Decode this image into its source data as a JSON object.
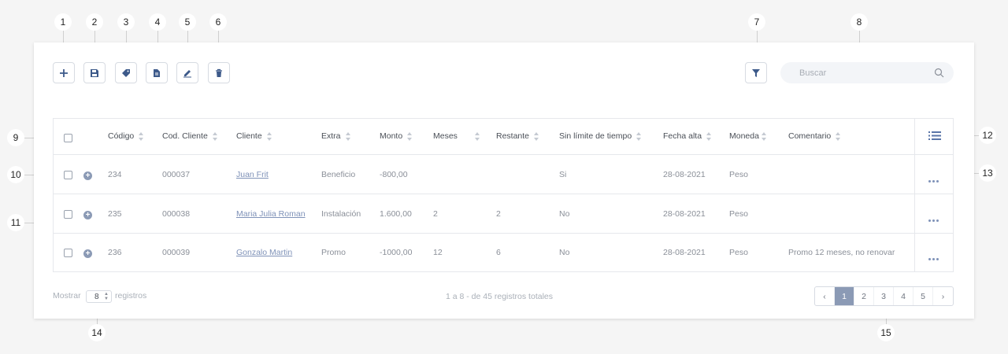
{
  "callouts": [
    "1",
    "2",
    "3",
    "4",
    "5",
    "6",
    "7",
    "8",
    "9",
    "10",
    "11",
    "12",
    "13",
    "14",
    "15"
  ],
  "toolbar": {
    "buttons": [
      {
        "icon": "plus-icon",
        "name": "add-button"
      },
      {
        "icon": "save-icon",
        "name": "save-button"
      },
      {
        "icon": "tag-icon",
        "name": "tag-button"
      },
      {
        "icon": "document-icon",
        "name": "document-button"
      },
      {
        "icon": "edit-icon",
        "name": "edit-button"
      },
      {
        "icon": "trash-icon",
        "name": "delete-button"
      }
    ],
    "filter_icon": "filter-icon"
  },
  "search": {
    "placeholder": "Buscar",
    "value": ""
  },
  "table": {
    "columns": [
      "Código",
      "Cod. Cliente",
      "Cliente",
      "Extra",
      "Monto",
      "Meses",
      "Restante",
      "Sin límite de tiempo",
      "Fecha alta",
      "Moneda",
      "Comentario"
    ],
    "rows": [
      {
        "codigo": "234",
        "cod_cliente": "000037",
        "cliente": "Juan Frit",
        "extra": "Beneficio",
        "monto": "-800,00",
        "meses": "",
        "restante": "",
        "sin_limite": "Si",
        "fecha_alta": "28-08-2021",
        "moneda": "Peso",
        "comentario": ""
      },
      {
        "codigo": "235",
        "cod_cliente": "000038",
        "cliente": "Maria Julia Roman",
        "extra": "Instalación",
        "monto": "1.600,00",
        "meses": "2",
        "restante": "2",
        "sin_limite": "No",
        "fecha_alta": "28-08-2021",
        "moneda": "Peso",
        "comentario": ""
      },
      {
        "codigo": "236",
        "cod_cliente": "000039",
        "cliente": "Gonzalo Martin",
        "extra": "Promo",
        "monto": "-1000,00",
        "meses": "12",
        "restante": "6",
        "sin_limite": "No",
        "fecha_alta": "28-08-2021",
        "moneda": "Peso",
        "comentario": "Promo 12 meses, no renovar"
      }
    ]
  },
  "footer": {
    "show_label": "Mostrar",
    "rows_per_page": "8",
    "registros_label": "registros",
    "summary": "1 a 8 - de 45 registros totales",
    "pages": [
      "1",
      "2",
      "3",
      "4",
      "5"
    ],
    "active_page": "1"
  },
  "colors": {
    "accent": "#8b9ab5",
    "link": "#7f92b8",
    "background": "#f5f5f5"
  }
}
